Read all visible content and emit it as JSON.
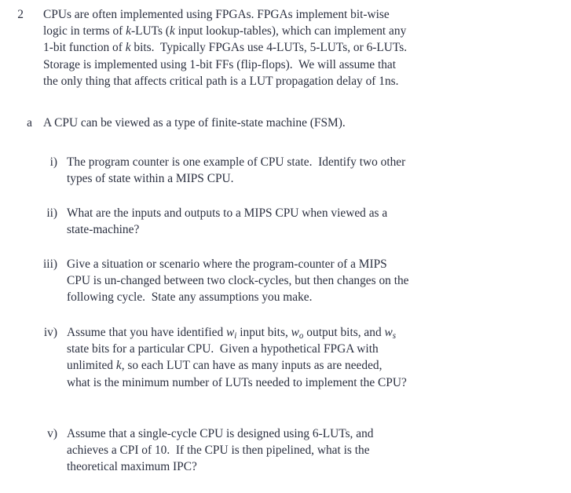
{
  "document": {
    "kind": "exam-question-page",
    "background_color": "#ffffff",
    "text_color": "#2b3040"
  },
  "question": {
    "number": "2",
    "intro_lines": [
      "CPUs are often implemented using FPGAs. FPGAs implement bit-wise",
      "logic in terms of k-LUTs (k input lookup-tables), which can implement any",
      "1-bit function of k bits. Typically FPGAs use 4-LUTs, 5-LUTs, or 6-LUTs.",
      "Storage is implemented using 1-bit FFs (flip-flops). We will assume that",
      "the only thing that affects critical path is a LUT propagation delay of 1ns."
    ],
    "intro_text": "CPUs are often implemented using FPGAs. FPGAs implement bit-wise logic in terms of k-LUTs (k input lookup-tables), which can implement any 1-bit function of k bits. Typically FPGAs use 4-LUTs, 5-LUTs, or 6-LUTs. Storage is implemented using 1-bit FFs (flip-flops). We will assume that the only thing that affects critical path is a LUT propagation delay of 1ns."
  },
  "part_a": {
    "marker": "a",
    "lines": [
      "A CPU can be viewed as a type of finite-state machine (FSM)."
    ],
    "text": "A CPU can be viewed as a type of finite-state machine (FSM)."
  },
  "items": [
    {
      "marker": "i)",
      "lines": [
        "The program counter is one example of CPU state. Identify two other",
        "types of state within a MIPS CPU."
      ],
      "text": "The program counter is one example of CPU state. Identify two other types of state within a MIPS CPU."
    },
    {
      "marker": "ii)",
      "lines": [
        "What are the inputs and outputs to a MIPS CPU when viewed as a",
        "state-machine?"
      ],
      "text": "What are the inputs and outputs to a MIPS CPU when viewed as a state-machine?"
    },
    {
      "marker": "iii)",
      "lines": [
        "Give a situation or scenario where the program-counter of a MIPS",
        "CPU is un-changed between two clock-cycles, but then changes on the",
        "following cycle. State any assumptions you make."
      ],
      "text": "Give a situation or scenario where the program-counter of a MIPS CPU is un-changed between two clock-cycles, but then changes on the following cycle. State any assumptions you make."
    },
    {
      "marker": "iv)",
      "lines": [
        "Assume that you have identified w_i input bits, w_o output bits, and w_s",
        "state bits for a particular CPU. Given a hypothetical FPGA with",
        "unlimited k, so each LUT can have as many inputs as are needed,",
        "what is the minimum number of LUTs needed to implement the CPU?"
      ],
      "text": "Assume that you have identified w_i input bits, w_o output bits, and w_s state bits for a particular CPU. Given a hypothetical FPGA with unlimited k, so each LUT can have as many inputs as are needed, what is the minimum number of LUTs needed to implement the CPU?",
      "math_variables": [
        "w_i",
        "w_o",
        "w_s",
        "k"
      ]
    },
    {
      "marker": "v)",
      "lines": [
        "Assume that a single-cycle CPU is designed using 6-LUTs, and",
        "achieves a CPI of 10. If the CPU is then pipelined, what is the",
        "theoretical maximum IPC?"
      ],
      "text": "Assume that a single-cycle CPU is designed using 6-LUTs, and achieves a CPI of 10. If the CPU is then pipelined, what is the theoretical maximum IPC?"
    }
  ],
  "fragments": {
    "q_l1_a": "CPUs are often implemented using FPGAs. FPGAs implement bit-wise",
    "q_l2_a": "logic in terms of ",
    "q_l2_k1": "k",
    "q_l2_b": "-LUTs (",
    "q_l2_k2": "k",
    "q_l2_c": " input lookup-tables), which can implement any",
    "q_l3_a": "1-bit function of ",
    "q_l3_k": "k",
    "q_l3_b": " bits.  Typically FPGAs use 4-LUTs, 5-LUTs, or 6-LUTs.",
    "q_l4_a": "Storage is implemented using 1-bit FFs (flip-flops).  We will assume that",
    "q_l5_a": "the only thing that affects critical path is a LUT propagation delay of 1ns.",
    "a_l1": "A CPU can be viewed as a type of finite-state machine (FSM).",
    "i_l1": "The program counter is one example of CPU state.  Identify two other",
    "i_l2": "types of state within a MIPS CPU.",
    "ii_l1": "What are the inputs and outputs to a MIPS CPU when viewed as a",
    "ii_l2": "state-machine?",
    "iii_l1": "Give a situation or scenario where the program-counter of a MIPS",
    "iii_l2": "CPU is un-changed between two clock-cycles, but then changes on the",
    "iii_l3": "following cycle.  State any assumptions you make.",
    "iv_l1_a": "Assume that you have identified ",
    "iv_l1_w1": "w",
    "iv_l1_w1s": "i",
    "iv_l1_b": " input bits, ",
    "iv_l1_w2": "w",
    "iv_l1_w2s": "o",
    "iv_l1_c": " output bits, and ",
    "iv_l1_w3": "w",
    "iv_l1_w3s": "s",
    "iv_l2": "state bits for a particular CPU.  Given a hypothetical FPGA with",
    "iv_l3_a": "unlimited ",
    "iv_l3_k": "k",
    "iv_l3_b": ", so each LUT can have as many inputs as are needed,",
    "iv_l4": "what is the minimum number of LUTs needed to implement the CPU?",
    "v_l1": "Assume that a single-cycle CPU is designed using 6-LUTs, and",
    "v_l2": "achieves a CPI of 10.  If the CPU is then pipelined, what is the",
    "v_l3": "theoretical maximum IPC?"
  }
}
